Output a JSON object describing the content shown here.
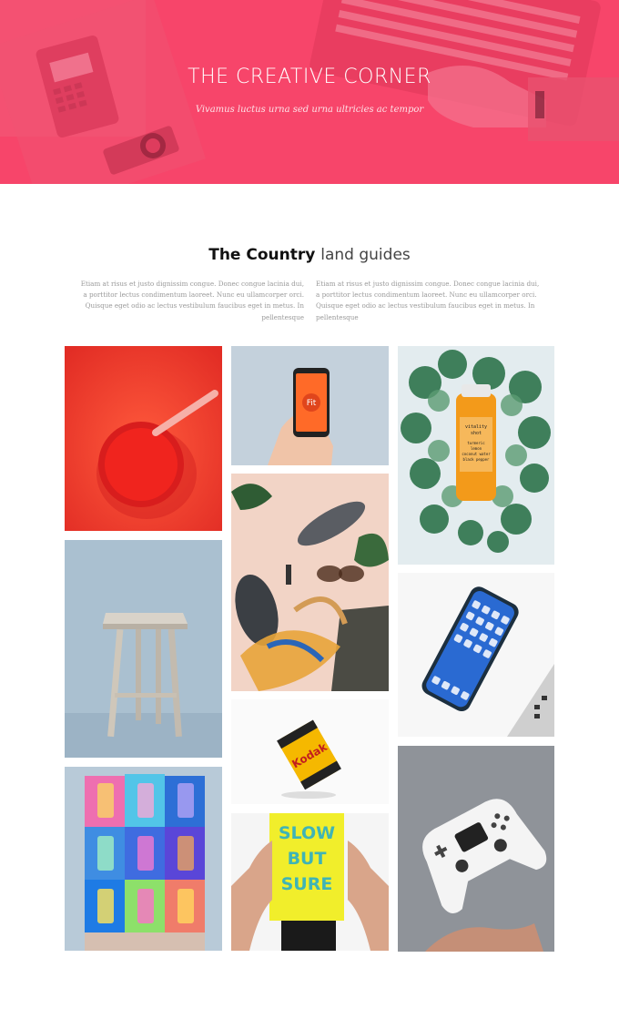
{
  "hero": {
    "title": "THE CREATIVE CORNER",
    "subtitle": "Vivamus luctus urna sed urna ultricies ac tempor",
    "accent_color": "#f7456a"
  },
  "intro": {
    "title_bold": "The Country",
    "title_light": "land guides",
    "col_left": "Etiam at risus et justo dignissim congue. Donec congue lacinia dui, a porttitor lectus condimentum laoreet. Nunc eu ullamcorper orci. Quisque eget odio ac lectus vestibulum faucibus eget in metus. In pellentesque",
    "col_right": "Etiam at risus et justo dignissim congue. Donec congue lacinia dui, a porttitor lectus condimentum laoreet. Nunc eu ullamcorper orci. Quisque eget odio ac lectus vestibulum faucibus eget in metus. In pellentesque"
  },
  "gallery": {
    "phone_screen_logo": "Fit",
    "bottle_label_lines": [
      "vitality",
      "shot",
      "turmeric",
      "lemon",
      "coconut water",
      "black pepper"
    ],
    "kodak_label": "Kodak",
    "poster_lines": [
      "SLOW",
      "BUT",
      "SURE"
    ],
    "icons": [
      "juice-cup-photo",
      "phone-in-hand-photo",
      "plant-bottle-photo",
      "stool-photo",
      "flatlay-sneakers-photo",
      "iphone-photo",
      "kodak-film-photo",
      "folded-paper-art-photo",
      "slow-but-sure-poster-photo",
      "game-controller-photo"
    ]
  }
}
